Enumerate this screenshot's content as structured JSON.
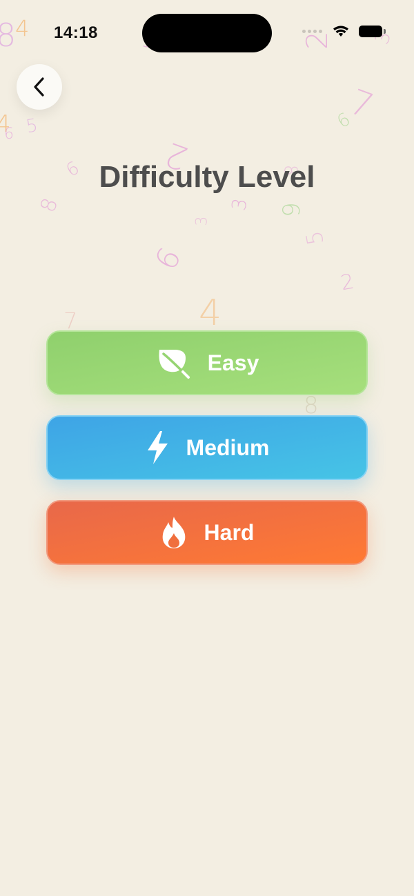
{
  "status_bar": {
    "time": "14:18"
  },
  "header": {
    "back_icon": "chevron-left-icon"
  },
  "title": "Difficulty Level",
  "options": [
    {
      "label": "Easy",
      "icon": "leaf-icon",
      "color": "#96d472"
    },
    {
      "label": "Medium",
      "icon": "lightning-icon",
      "color": "#41b2e6"
    },
    {
      "label": "Hard",
      "icon": "flame-icon",
      "color": "#f06f3e"
    }
  ],
  "background_digits": [
    "8",
    "4",
    "4",
    "5",
    "6",
    "2",
    "9",
    "8",
    "3",
    "3",
    "9",
    "5",
    "2",
    "4",
    "7",
    "6",
    "7",
    "8",
    "3",
    "2",
    "8",
    "6",
    "5"
  ]
}
